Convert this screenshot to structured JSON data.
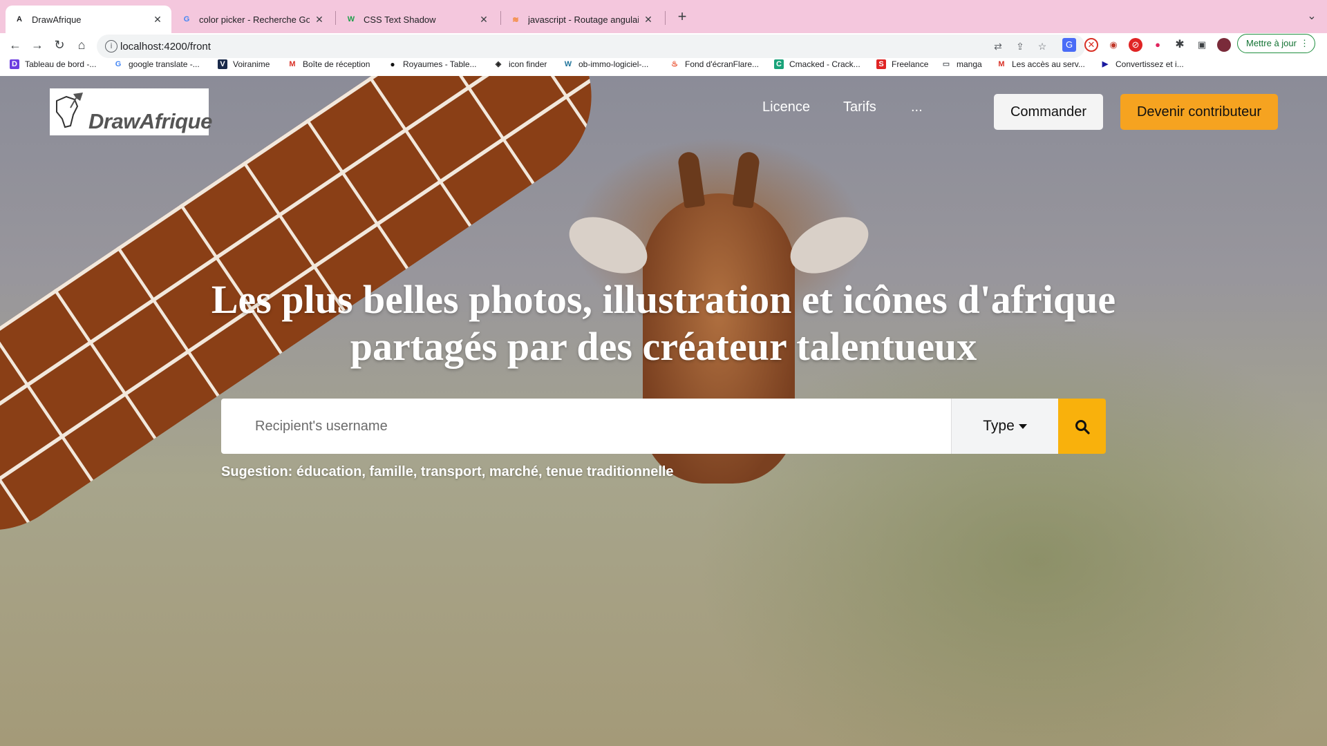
{
  "browser": {
    "tabs": [
      {
        "title": "DrawAfrique",
        "icon": "angular-icon",
        "active": true
      },
      {
        "title": "color picker - Recherche Goog",
        "icon": "google-icon"
      },
      {
        "title": "CSS Text Shadow",
        "icon": "w-icon"
      },
      {
        "title": "javascript - Routage angulaire",
        "icon": "stackoverflow-icon"
      }
    ],
    "new_tab": "+",
    "url": "localhost:4200/front",
    "update_label": "Mettre à jour",
    "bookmarks": [
      {
        "label": "Tableau de bord -...",
        "icon": "dashboard-icon",
        "color": "#6c3ce0"
      },
      {
        "label": "google translate -...",
        "icon": "google-icon",
        "color": "#4285f4"
      },
      {
        "label": "Voiranime",
        "icon": "va-icon",
        "color": "#1a2a4a"
      },
      {
        "label": "Boîte de réception",
        "icon": "gmail-icon",
        "color": "#d93025"
      },
      {
        "label": "Royaumes - Table...",
        "icon": "circle-icon",
        "color": "#111111"
      },
      {
        "label": "icon finder",
        "icon": "iconfinder-icon",
        "color": "#222222"
      },
      {
        "label": "ob-immo-logiciel-...",
        "icon": "wordpress-icon",
        "color": "#21759b"
      },
      {
        "label": "Fond d'écranFlare...",
        "icon": "flame-icon",
        "color": "#e8431f"
      },
      {
        "label": "Cmacked - Crack...",
        "icon": "c-icon",
        "color": "#1aa37a"
      },
      {
        "label": "Freelance",
        "icon": "s-icon",
        "color": "#e02424"
      },
      {
        "label": "manga",
        "icon": "folder-icon",
        "color": "#5f6368"
      },
      {
        "label": "Les accès au serv...",
        "icon": "gmail-icon",
        "color": "#d93025"
      },
      {
        "label": "Convertissez et i...",
        "icon": "convert-icon",
        "color": "#1a1aa0"
      }
    ]
  },
  "site": {
    "logo_text": "DrawAfrique",
    "nav": {
      "licence": "Licence",
      "tarifs": "Tarifs",
      "more": "..."
    },
    "order_label": "Commander",
    "contrib_label": "Devenir contributeur",
    "headline_line1": "Les plus belles photos, illustration et icônes d'afrique",
    "headline_line2": "partagés par des créateur talentueux",
    "search": {
      "placeholder": "Recipient's username",
      "type_label": "Type"
    },
    "suggestion": "Sugestion: éducation, famille, transport, marché, tenue traditionnelle"
  },
  "colors": {
    "accent_orange": "#f6a320",
    "search_button": "#f9b10c",
    "tabstrip": "#f4c7dd"
  }
}
